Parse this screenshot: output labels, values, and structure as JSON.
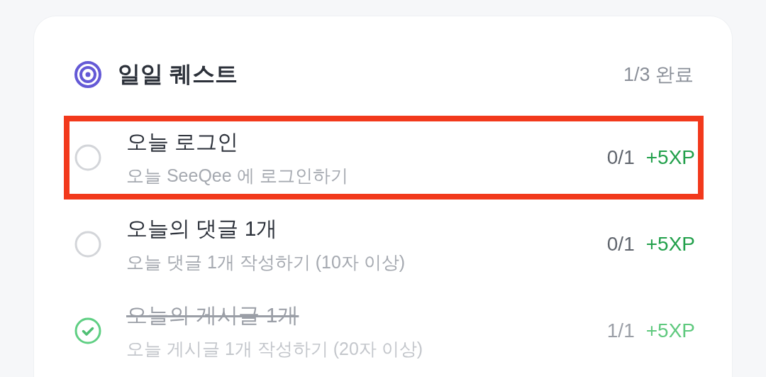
{
  "header": {
    "title": "일일 퀘스트",
    "progress": "1/3 완료"
  },
  "quests": [
    {
      "title": "오늘 로그인",
      "description": "오늘 SeeQee 에 로그인하기",
      "count": "0/1",
      "reward": "+5XP",
      "completed": false,
      "highlighted": true
    },
    {
      "title": "오늘의 댓글 1개",
      "description": "오늘 댓글 1개 작성하기 (10자 이상)",
      "count": "0/1",
      "reward": "+5XP",
      "completed": false,
      "highlighted": false
    },
    {
      "title": "오늘의 게시글 1개",
      "description": "오늘 게시글 1개 작성하기 (20자 이상)",
      "count": "1/1",
      "reward": "+5XP",
      "completed": true,
      "highlighted": false
    }
  ]
}
